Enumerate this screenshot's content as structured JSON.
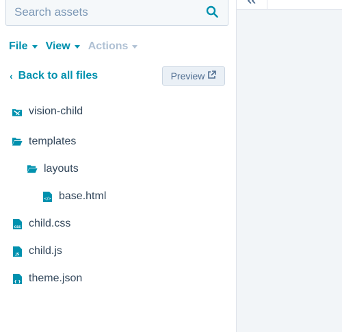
{
  "search": {
    "placeholder": "Search assets"
  },
  "menu": {
    "file_label": "File",
    "view_label": "View",
    "actions_label": "Actions"
  },
  "nav": {
    "back_label": "Back to all files",
    "preview_label": "Preview"
  },
  "tree": [
    {
      "label": "vision-child",
      "icon": "theme-icon"
    },
    {
      "label": "templates",
      "icon": "folder-open-icon"
    },
    {
      "label": "layouts",
      "icon": "folder-open-icon"
    },
    {
      "label": "base.html",
      "icon": "html-file-icon"
    },
    {
      "label": "child.css",
      "icon": "css-file-icon"
    },
    {
      "label": "child.js",
      "icon": "js-file-icon"
    },
    {
      "label": "theme.json",
      "icon": "json-file-icon"
    }
  ],
  "colors": {
    "accent": "#0091ae",
    "icon": "#0091ae",
    "text": "#33475b",
    "disabled": "#b0c1d4",
    "panel_bg": "#f2f5f8"
  }
}
